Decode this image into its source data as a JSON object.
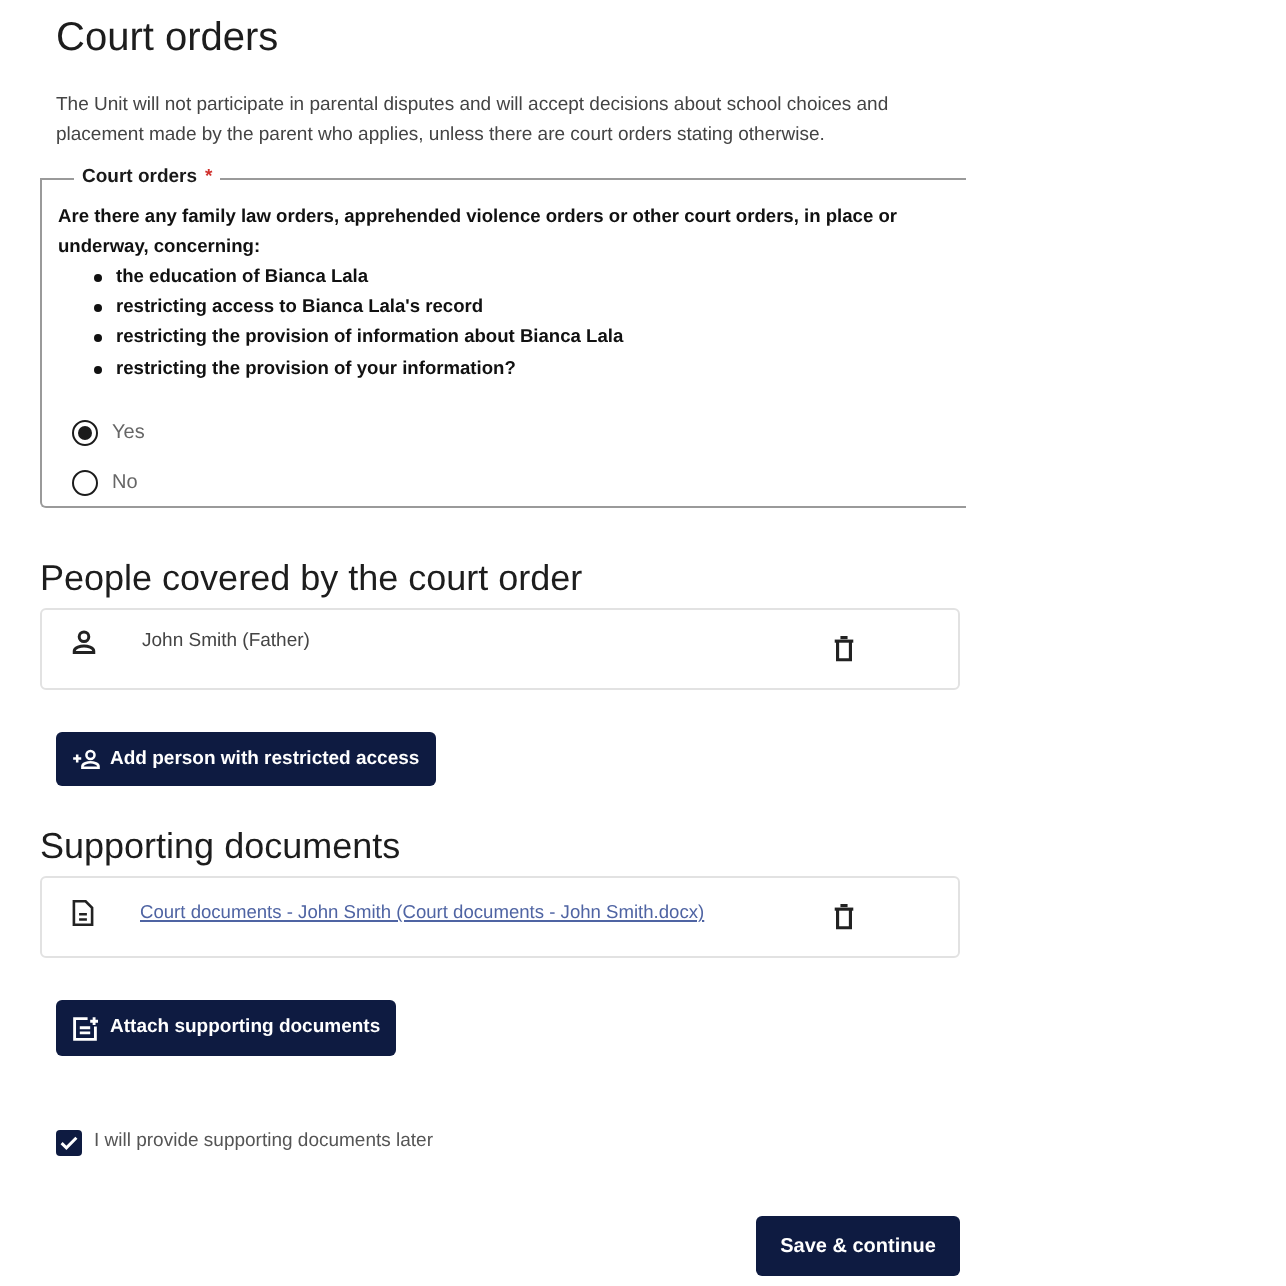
{
  "page": {
    "title": "Court orders",
    "intro": "The Unit will not participate in parental disputes and will accept decisions about school choices and placement made by the parent who applies, unless there are court orders stating otherwise."
  },
  "court_orders": {
    "legend": "Court orders",
    "required_mark": "*",
    "question": "Are there any family law orders, apprehended violence orders or other court orders, in place or underway, concerning:",
    "bullets": [
      "the education of Bianca Lala",
      "restricting access to Bianca Lala's record",
      "restricting the provision of information about Bianca Lala",
      "restricting the provision of your information?"
    ],
    "options": [
      {
        "label": "Yes",
        "selected": true
      },
      {
        "label": "No",
        "selected": false
      }
    ]
  },
  "people": {
    "heading": "People covered by the court order",
    "items": [
      {
        "name": "John Smith (Father)"
      }
    ],
    "add_button": "Add person with restricted access"
  },
  "documents": {
    "heading": "Supporting documents",
    "items": [
      {
        "name": "Court documents - John Smith (Court documents - John Smith.docx)"
      }
    ],
    "attach_button": "Attach supporting documents",
    "provide_later": {
      "label": "I will provide supporting documents later",
      "checked": true
    }
  },
  "save_button": "Save & continue"
}
